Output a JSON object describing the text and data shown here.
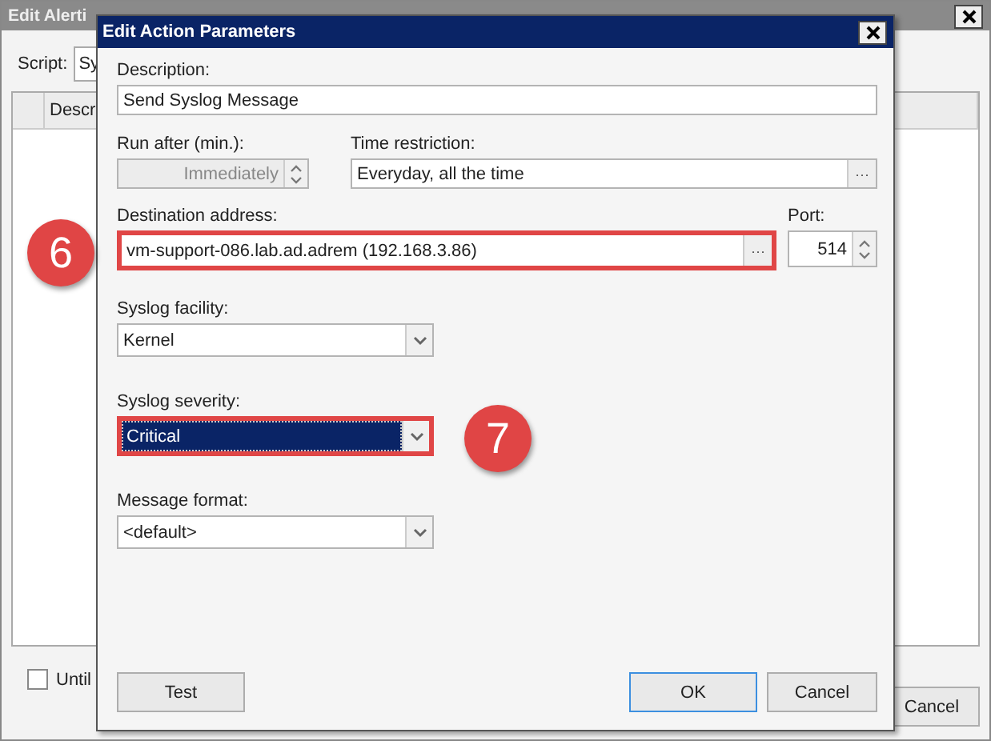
{
  "background_window": {
    "title": "Edit Alerti",
    "script_label": "Script:",
    "script_value": "Sy",
    "table": {
      "columns": [
        "Descr"
      ]
    },
    "checkbox": {
      "label": "Until",
      "checked": false
    },
    "buttons": [
      "Cancel"
    ]
  },
  "dialog": {
    "title": "Edit Action Parameters",
    "description": {
      "label": "Description:",
      "value": "Send Syslog Message"
    },
    "run_after": {
      "label": "Run after (min.):",
      "value": "Immediately",
      "disabled": true
    },
    "time_restriction": {
      "label": "Time restriction:",
      "value": "Everyday, all the time",
      "button": "···"
    },
    "destination": {
      "label": "Destination address:",
      "value": "vm-support-086.lab.ad.adrem (192.168.3.86)",
      "button": "···",
      "highlighted": true
    },
    "port": {
      "label": "Port:",
      "value": "514",
      "disabled": false
    },
    "selects": [
      {
        "label": "Syslog facility:",
        "value": "Kernel",
        "selected": false,
        "highlighted": false
      },
      {
        "label": "Syslog severity:",
        "value": "Critical",
        "selected": true,
        "highlighted": true
      },
      {
        "label": "Message format:",
        "value": "<default>",
        "selected": false,
        "highlighted": false
      }
    ],
    "buttons": [
      {
        "label": "Test",
        "kind": "left",
        "default": false
      },
      {
        "label": "OK",
        "kind": "right",
        "default": true
      },
      {
        "label": "Cancel",
        "kind": "right",
        "default": false
      }
    ]
  },
  "annotations": [
    {
      "label": "6"
    },
    {
      "label": "7"
    }
  ]
}
